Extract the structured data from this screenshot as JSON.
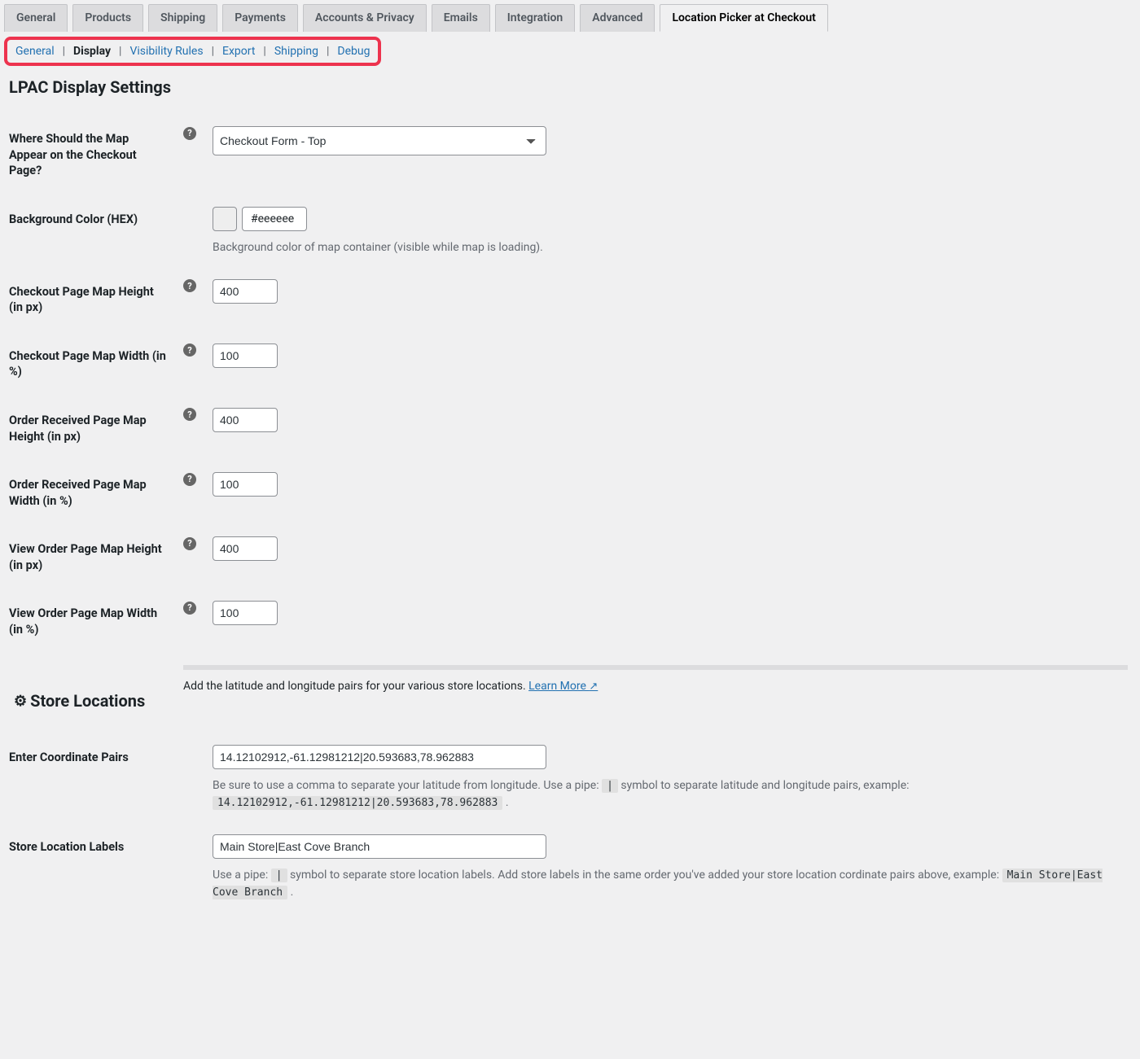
{
  "tabs": {
    "general": "General",
    "products": "Products",
    "shipping": "Shipping",
    "payments": "Payments",
    "accounts": "Accounts & Privacy",
    "emails": "Emails",
    "integration": "Integration",
    "advanced": "Advanced",
    "lpac": "Location Picker at Checkout"
  },
  "subnav": {
    "general": "General",
    "display": "Display",
    "visibility": "Visibility Rules",
    "export": "Export",
    "shipping": "Shipping",
    "debug": "Debug"
  },
  "page_title": "LPAC Display Settings",
  "fields": {
    "map_position": {
      "label": "Where Should the Map Appear on the Checkout Page?",
      "value": "Checkout Form - Top"
    },
    "bg_color": {
      "label": "Background Color (HEX)",
      "value": "#eeeeee",
      "swatch": "#eeeeee",
      "desc": "Background color of map container (visible while map is loading)."
    },
    "checkout_height": {
      "label": "Checkout Page Map Height (in px)",
      "value": "400"
    },
    "checkout_width": {
      "label": "Checkout Page Map Width (in %)",
      "value": "100"
    },
    "order_received_height": {
      "label": "Order Received Page Map Height (in px)",
      "value": "400"
    },
    "order_received_width": {
      "label": "Order Received Page Map Width (in %)",
      "value": "100"
    },
    "view_order_height": {
      "label": "View Order Page Map Height (in px)",
      "value": "400"
    },
    "view_order_width": {
      "label": "View Order Page Map Width (in %)",
      "value": "100"
    }
  },
  "store_locations": {
    "heading": "Store Locations",
    "intro_prefix": "Add the latitude and longitude pairs for your various store locations. ",
    "learn_more": "Learn More ",
    "coord_pairs": {
      "label": "Enter Coordinate Pairs",
      "value": "14.12102912,-61.12981212|20.593683,78.962883",
      "desc_pre": "Be sure to use a comma to separate your latitude from longitude. Use a pipe: ",
      "pipe": "|",
      "desc_mid": " symbol to separate latitude and longitude pairs, example: ",
      "example": "14.12102912,-61.12981212|20.593683,78.962883",
      "desc_end": " ."
    },
    "labels": {
      "label": "Store Location Labels",
      "value": "Main Store|East Cove Branch",
      "desc_pre": "Use a pipe: ",
      "pipe": "|",
      "desc_mid": " symbol to separate store location labels. Add store labels in the same order you've added your store location cordinate pairs above, example: ",
      "example": "Main Store|East Cove Branch",
      "desc_end": " ."
    }
  },
  "help_glyph": "?"
}
